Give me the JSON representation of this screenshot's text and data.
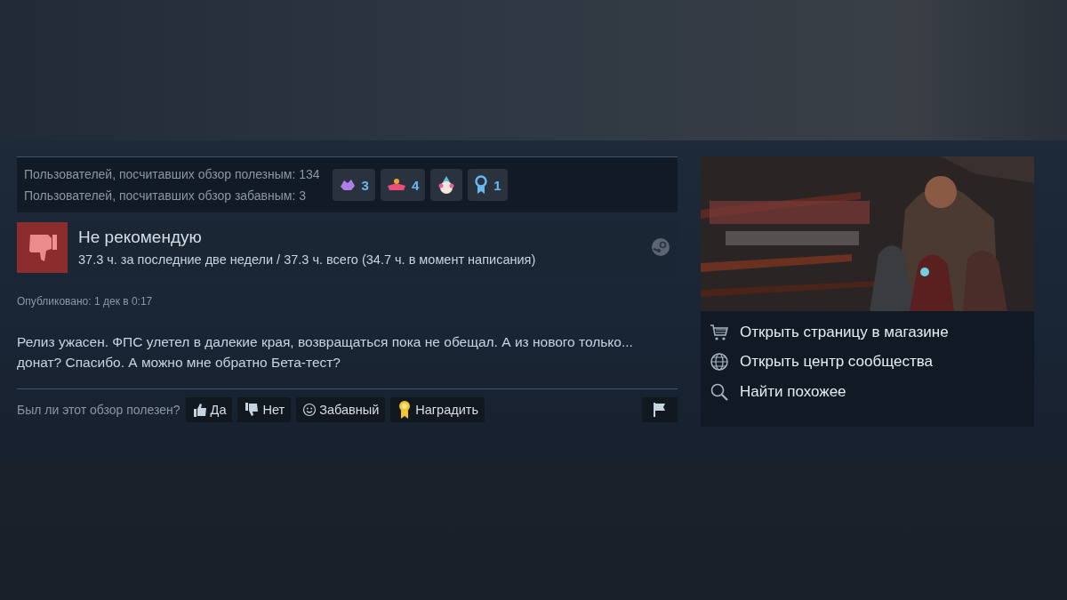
{
  "stats": {
    "helpful": "Пользователей, посчитавших обзор полезным: 134",
    "funny": "Пользователей, посчитавших обзор забавным: 3"
  },
  "awards": [
    {
      "kind": "crystal",
      "count": "3"
    },
    {
      "kind": "handshake",
      "count": "4"
    },
    {
      "kind": "clown"
    },
    {
      "kind": "ribbon",
      "count": "1"
    }
  ],
  "review": {
    "recommended": false,
    "verdict": "Не рекомендую",
    "hours": "37.3 ч. за последние две недели / 37.3 ч. всего (34.7 ч. в момент написания)",
    "posted": "Опубликовано: 1 дек в 0:17",
    "text": "Релиз ужасен. ФПС улетел в далекие края, возвращаться пока не обещал. А из нового только... донат? Спасибо. А можно мне обратно Бета-тест?"
  },
  "vote": {
    "question": "Был ли этот обзор полезен?",
    "buttons": [
      {
        "kind": "yes",
        "label": "Да"
      },
      {
        "kind": "no",
        "label": "Нет"
      },
      {
        "kind": "funny",
        "label": "Забавный"
      },
      {
        "kind": "award",
        "label": "Наградить"
      }
    ]
  },
  "game": {
    "links": [
      {
        "kind": "store",
        "label": "Открыть страницу в магазине"
      },
      {
        "kind": "community",
        "label": "Открыть центр сообщества"
      },
      {
        "kind": "similar",
        "label": "Найти похожее"
      }
    ]
  }
}
